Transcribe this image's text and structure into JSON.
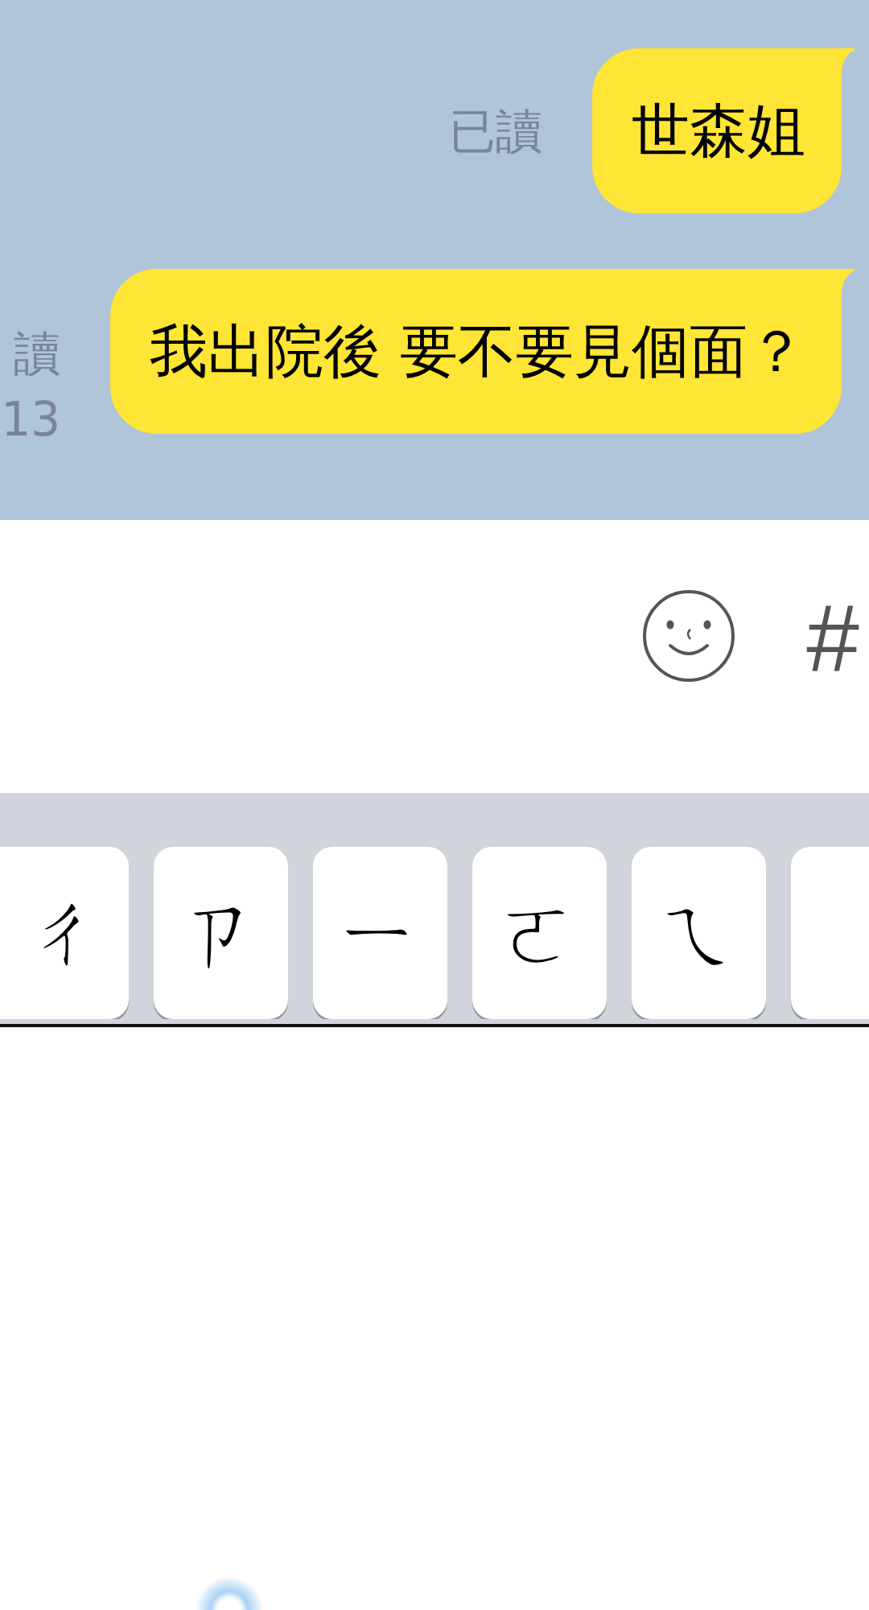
{
  "chat": {
    "messages": [
      {
        "text": "世森姐",
        "read_status": "已讀"
      },
      {
        "text": "我出院後 要不要見個面？",
        "read_status": "讀",
        "time": "13"
      }
    ]
  },
  "input_bar": {
    "hash_key": "#"
  },
  "keyboard": {
    "keys": [
      {
        "kind": "letter",
        "label": "ㄔ"
      },
      {
        "kind": "letter",
        "label": "ㄗ"
      },
      {
        "kind": "letter",
        "label": "ㄧ"
      },
      {
        "kind": "letter",
        "label": "ㄛ"
      },
      {
        "kind": "letter",
        "label": "ㄟ"
      },
      {
        "kind": "blank"
      }
    ]
  }
}
